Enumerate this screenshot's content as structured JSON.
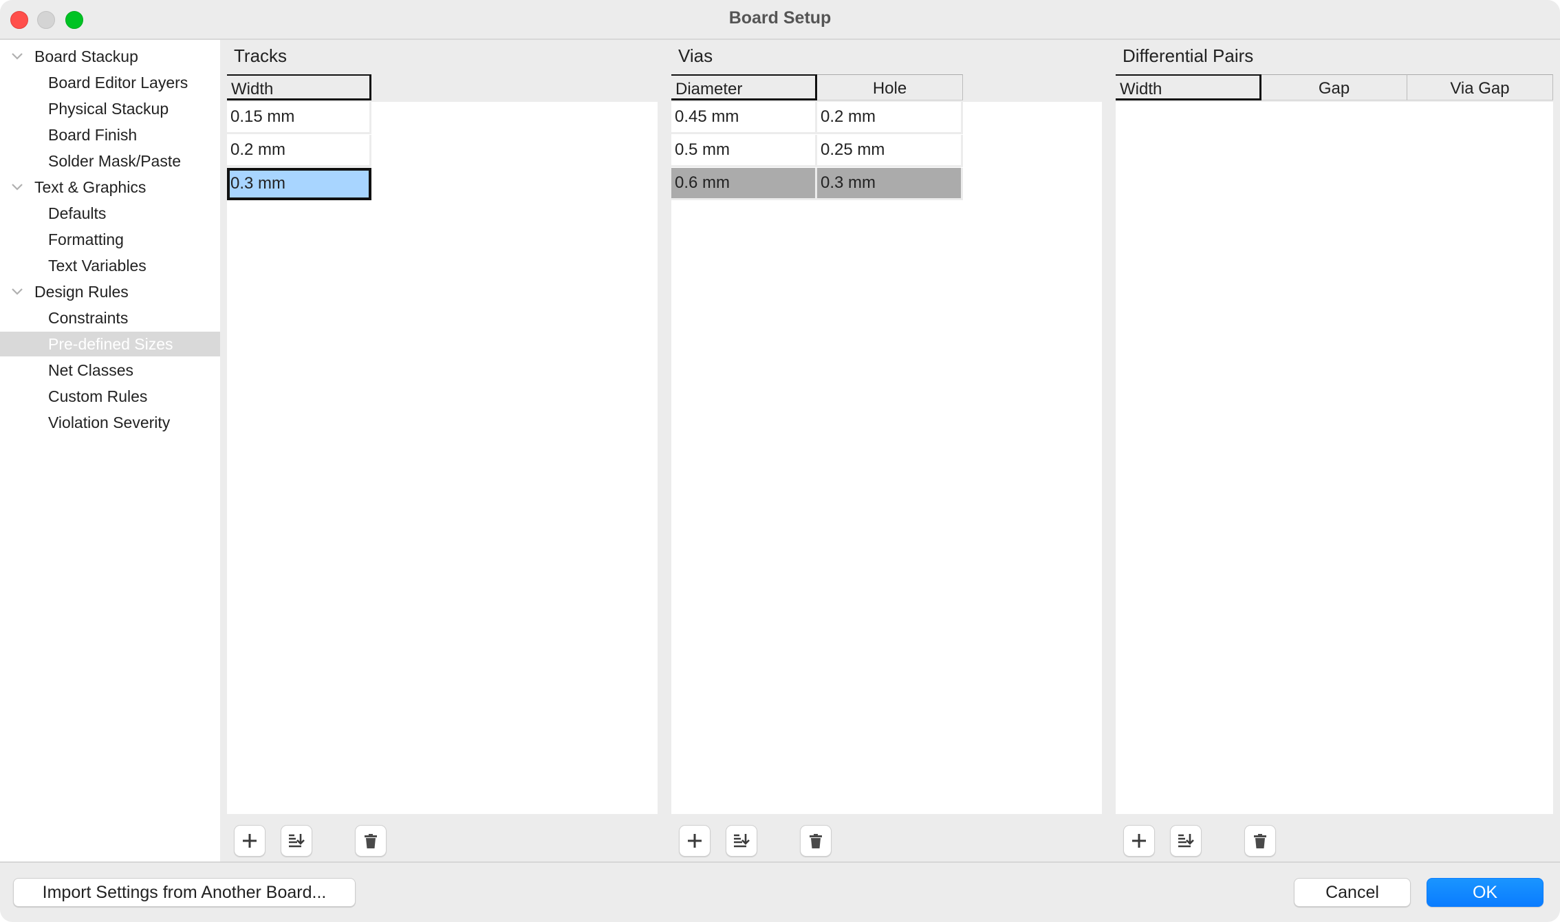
{
  "window": {
    "title": "Board Setup"
  },
  "sidebar": {
    "items": [
      {
        "label": "Board Stackup",
        "level": 0,
        "expanded": true
      },
      {
        "label": "Board Editor Layers",
        "level": 1
      },
      {
        "label": "Physical Stackup",
        "level": 1
      },
      {
        "label": "Board Finish",
        "level": 1
      },
      {
        "label": "Solder Mask/Paste",
        "level": 1
      },
      {
        "label": "Text & Graphics",
        "level": 0,
        "expanded": true
      },
      {
        "label": "Defaults",
        "level": 1
      },
      {
        "label": "Formatting",
        "level": 1
      },
      {
        "label": "Text Variables",
        "level": 1
      },
      {
        "label": "Design Rules",
        "level": 0,
        "expanded": true
      },
      {
        "label": "Constraints",
        "level": 1
      },
      {
        "label": "Pre-defined Sizes",
        "level": 1,
        "selected": true
      },
      {
        "label": "Net Classes",
        "level": 1
      },
      {
        "label": "Custom Rules",
        "level": 1
      },
      {
        "label": "Violation Severity",
        "level": 1
      }
    ]
  },
  "tracks": {
    "title": "Tracks",
    "columns": [
      "Width"
    ],
    "rows": [
      [
        "0.15 mm"
      ],
      [
        "0.2 mm"
      ],
      [
        "0.3 mm"
      ]
    ],
    "selected_row": 2
  },
  "vias": {
    "title": "Vias",
    "columns": [
      "Diameter",
      "Hole"
    ],
    "rows": [
      [
        "0.45 mm",
        "0.2 mm"
      ],
      [
        "0.5 mm",
        "0.25 mm"
      ],
      [
        "0.6 mm",
        "0.3 mm"
      ]
    ],
    "selected_row": 2
  },
  "diff_pairs": {
    "title": "Differential Pairs",
    "columns": [
      "Width",
      "Gap",
      "Via Gap"
    ],
    "rows": []
  },
  "grid_buttons": {
    "add": "add-row",
    "sort": "sort-rows",
    "delete": "delete-row"
  },
  "footer": {
    "import_label": "Import Settings from Another Board...",
    "cancel_label": "Cancel",
    "ok_label": "OK"
  },
  "colors": {
    "accent": "#0a7cff",
    "selection_blue": "#a8d5ff",
    "selection_gray": "#ababab"
  }
}
